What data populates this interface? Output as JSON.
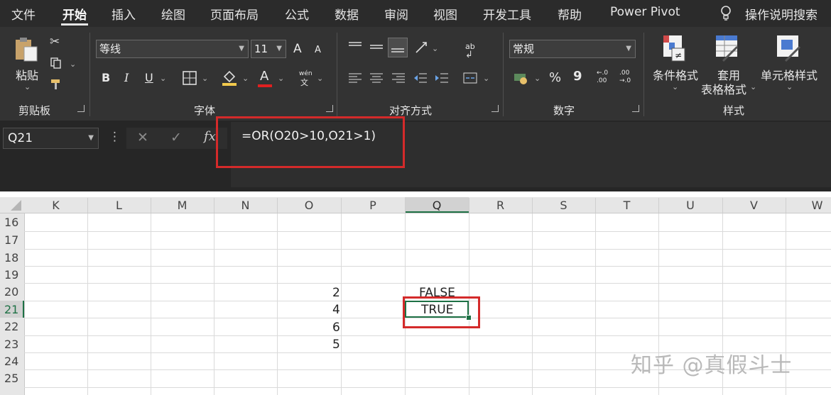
{
  "tabs": [
    "文件",
    "开始",
    "插入",
    "绘图",
    "页面布局",
    "公式",
    "数据",
    "审阅",
    "视图",
    "开发工具",
    "帮助",
    "Power Pivot"
  ],
  "active_tab": "开始",
  "tell_me": "操作说明搜索",
  "clipboard": {
    "paste": "粘贴",
    "label": "剪贴板"
  },
  "font": {
    "name": "等线",
    "size": "11",
    "grow": "A",
    "shrink": "A",
    "bold": "B",
    "italic": "I",
    "underline": "U",
    "color_letter": "A",
    "phonetic": "wén",
    "label": "字体"
  },
  "alignment": {
    "wrap": "ab",
    "label": "对齐方式"
  },
  "number": {
    "format": "常规",
    "percent": "%",
    "comma": "9",
    "inc_decimal": ".00",
    "dec_decimal": ".00",
    "label": "数字"
  },
  "styles": {
    "conditional": "条件格式",
    "table_line1": "套用",
    "table_line2": "表格格式",
    "cell_styles": "单元格样式",
    "label": "样式"
  },
  "formula_bar": {
    "name_box": "Q21",
    "fx": "fx",
    "formula": "=OR(O20>10,O21>1)"
  },
  "columns": [
    "K",
    "L",
    "M",
    "N",
    "O",
    "P",
    "Q",
    "R",
    "S",
    "T",
    "U",
    "V",
    "W"
  ],
  "rows": [
    "16",
    "17",
    "18",
    "19",
    "20",
    "21",
    "22",
    "23",
    "24",
    "25"
  ],
  "cells": {
    "o20": "2",
    "o21": "4",
    "o22": "6",
    "o23": "5",
    "q20": "FALSE",
    "q21": "TRUE"
  },
  "watermark": "知乎 @真假斗士",
  "colors": {
    "ribbon": "#333333",
    "selection_green": "#1e7145",
    "highlight_red": "#d42a2a"
  }
}
